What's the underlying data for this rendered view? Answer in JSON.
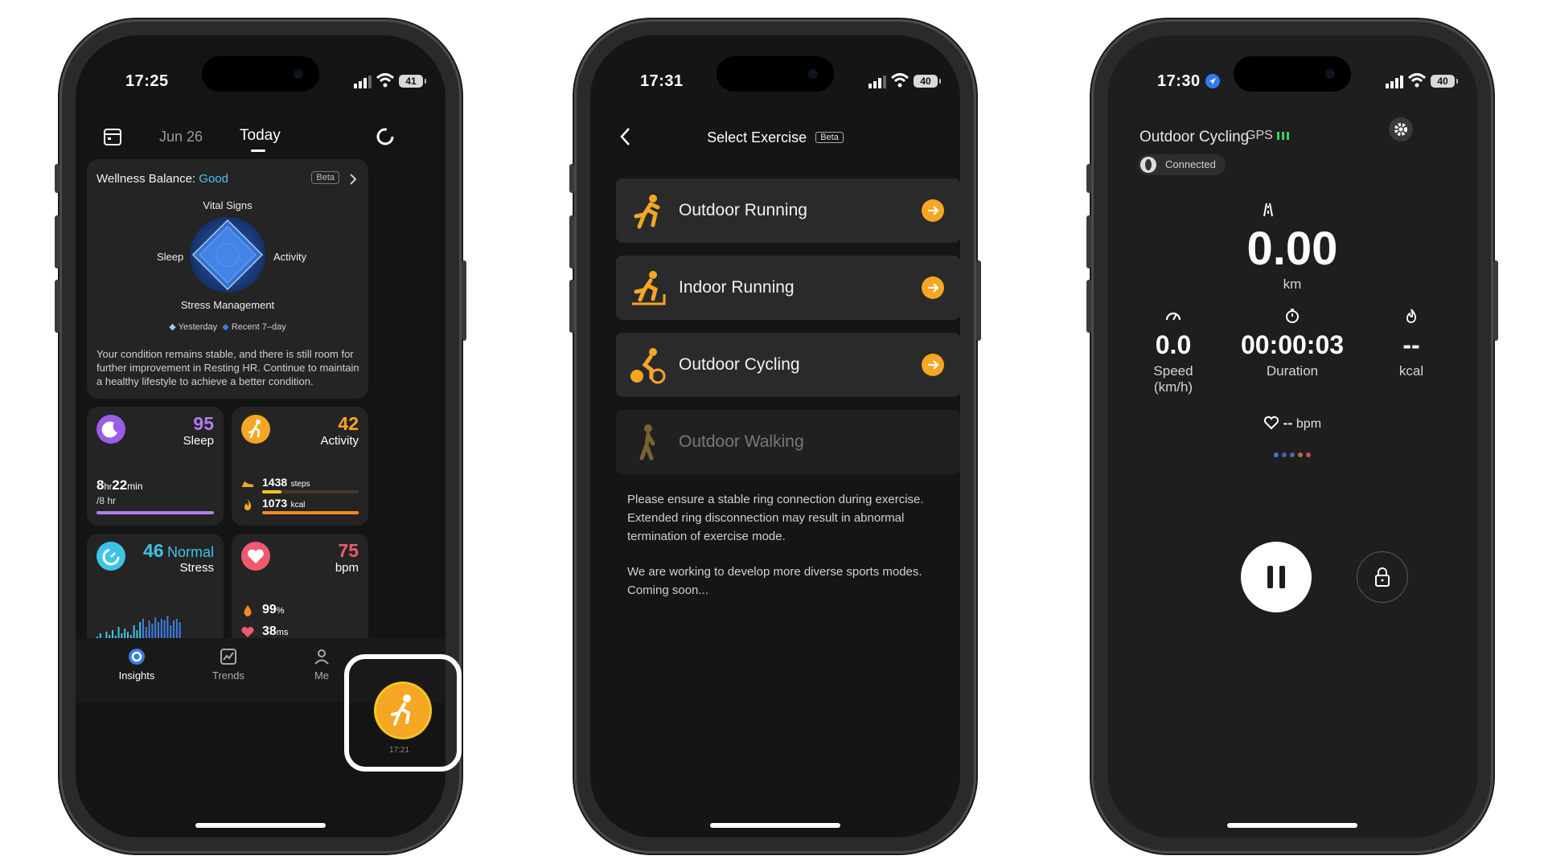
{
  "phones": [
    {
      "status": {
        "time": "17:25",
        "battery": "41"
      },
      "header": {
        "prev_date": "Jun 26",
        "active_date": "Today"
      },
      "wellness": {
        "title": "Wellness Balance:",
        "status": "Good",
        "badge": "Beta",
        "axes": {
          "top": "Vital Signs",
          "left": "Sleep",
          "right": "Activity",
          "bottom": "Stress Management"
        },
        "legend": [
          "Yesterday",
          "Recent 7–day"
        ],
        "description": "Your condition remains stable, and there is still room for further improvement in Resting HR. Continue to maintain a healthy lifestyle to achieve a better condition."
      },
      "sleep_card": {
        "score": "95",
        "label": "Sleep",
        "hours": "8",
        "hr_unit": "hr",
        "minutes": "22",
        "min_unit": "min",
        "goal": "/8 hr",
        "progress": 1.0,
        "color": "#b57bf0"
      },
      "activity_card": {
        "score": "42",
        "label": "Activity",
        "steps": "1438",
        "steps_unit": "steps",
        "steps_progress": 0.2,
        "kcal": "1073",
        "kcal_unit": "kcal",
        "kcal_progress": 1.0,
        "color": "#f5a623"
      },
      "stress_card": {
        "score": "46",
        "level": "Normal",
        "label": "Stress",
        "color": "#3cc4e6"
      },
      "heart_card": {
        "score": "75",
        "unit": "bpm",
        "spo2": "99",
        "spo2_unit": "%",
        "hrv": "38",
        "hrv_unit": "ms",
        "color": "#f05a6e"
      },
      "fab": {
        "time": "17:21"
      },
      "tabbar": [
        {
          "label": "Insights",
          "active": true
        },
        {
          "label": "Trends",
          "active": false
        },
        {
          "label": "Me",
          "active": false
        }
      ]
    },
    {
      "status": {
        "time": "17:31",
        "battery": "40"
      },
      "header": {
        "title": "Select Exercise",
        "badge": "Beta"
      },
      "exercises": [
        {
          "label": "Outdoor Running",
          "enabled": true,
          "icon": "running-icon"
        },
        {
          "label": "Indoor Running",
          "enabled": true,
          "icon": "treadmill-icon"
        },
        {
          "label": "Outdoor Cycling",
          "enabled": true,
          "icon": "cycling-icon"
        },
        {
          "label": "Outdoor Walking",
          "enabled": false,
          "icon": "walking-icon"
        }
      ],
      "note1": "Please ensure a stable ring connection during exercise. Extended ring disconnection may result in abnormal termination of exercise mode.",
      "note2": "We are working to develop more diverse sports modes. Coming soon..."
    },
    {
      "status": {
        "time": "17:30",
        "battery": "40"
      },
      "header": {
        "title": "Outdoor Cycling",
        "gps": "GPS"
      },
      "connection": "Connected",
      "distance": {
        "value": "0.00",
        "unit": "km"
      },
      "stats": [
        {
          "value": "0.0",
          "label1": "Speed",
          "label2": "(km/h)",
          "icon": "speedometer-icon"
        },
        {
          "value": "00:00:03",
          "label1": "Duration",
          "label2": "",
          "icon": "stopwatch-icon"
        },
        {
          "value": "--",
          "label1": "kcal",
          "label2": "",
          "icon": "flame-icon"
        }
      ],
      "heart": {
        "value": "--",
        "unit": "bpm"
      },
      "dots": [
        "#4a6fd1",
        "#5a5ab0",
        "#4a6f9a",
        "#b0703a",
        "#c05050"
      ]
    }
  ]
}
